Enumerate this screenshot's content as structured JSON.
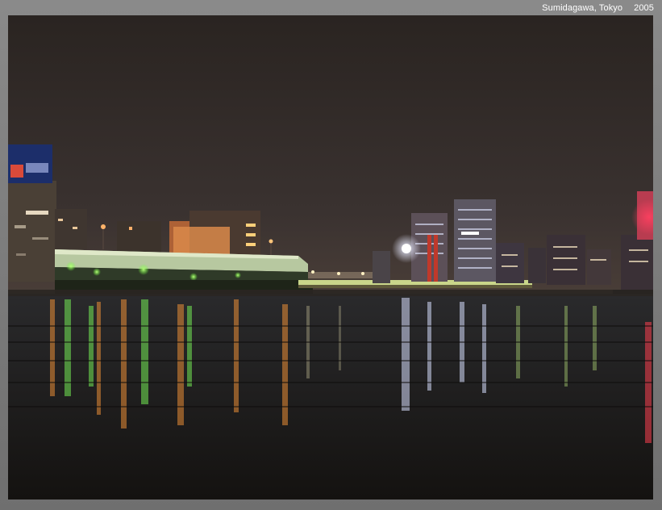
{
  "caption": {
    "location": "Sumidagawa, Tokyo",
    "year": "2005"
  },
  "photo": {
    "subject": "night-river-cityscape",
    "colors": {
      "sky": "#2e2825",
      "water": "#1f1c1a",
      "bridge_light": "#c9e08a",
      "green_light": "#7cff5a",
      "orange_light": "#ff8a2a",
      "red_tower": "#b53a2a",
      "spotlight": "#ffffff"
    }
  }
}
